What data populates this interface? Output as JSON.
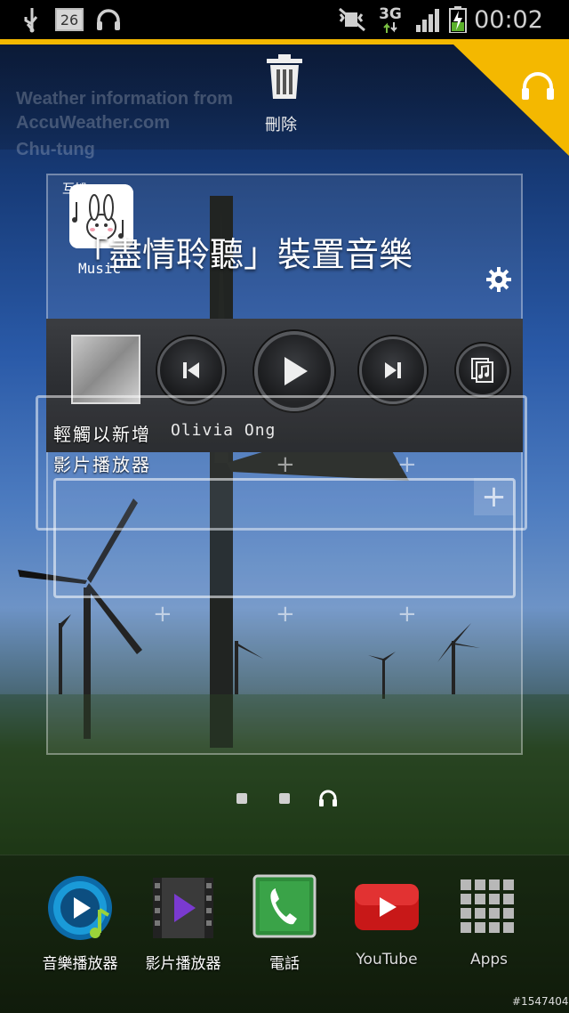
{
  "status_bar": {
    "notification_badge": "26",
    "network_type": "3G",
    "time": "00:02"
  },
  "top_bar": {
    "delete_label": "刪除",
    "ghost_line1": "Weather information from",
    "ghost_line2": "AccuWeather.com",
    "ghost_line3": "Chu-tung"
  },
  "music_widget": {
    "icon_top_text": "互娛",
    "icon_label": "Music",
    "title": "「盡情聆聽」裝置音樂",
    "song_artist": "Olivia Ong"
  },
  "drag_labels": {
    "line1": "輕觸以新增",
    "line2": "影片播放器"
  },
  "dock": {
    "items": [
      {
        "label": "音樂播放器",
        "icon": "music-player-icon"
      },
      {
        "label": "影片播放器",
        "icon": "video-player-icon"
      },
      {
        "label": "電話",
        "icon": "phone-icon"
      },
      {
        "label": "YouTube",
        "icon": "youtube-icon"
      },
      {
        "label": "Apps",
        "icon": "apps-grid-icon"
      }
    ]
  },
  "watermark": "#1547404",
  "colors": {
    "accent_yellow": "#f4b800",
    "status_bar": "#000000",
    "phone_green": "#2e8b3a",
    "youtube_red": "#c81818"
  }
}
